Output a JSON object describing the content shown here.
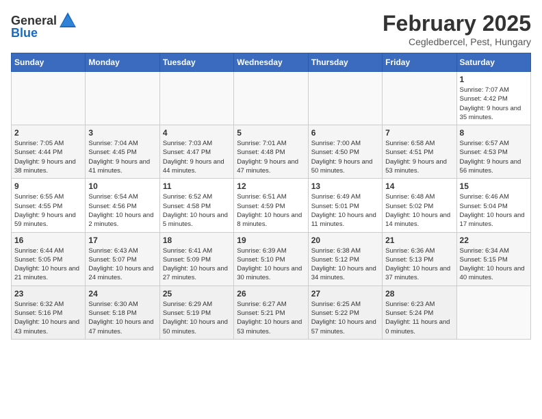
{
  "header": {
    "logo_general": "General",
    "logo_blue": "Blue",
    "month": "February 2025",
    "location": "Cegledbercel, Pest, Hungary"
  },
  "days_of_week": [
    "Sunday",
    "Monday",
    "Tuesday",
    "Wednesday",
    "Thursday",
    "Friday",
    "Saturday"
  ],
  "weeks": [
    [
      {
        "day": "",
        "info": ""
      },
      {
        "day": "",
        "info": ""
      },
      {
        "day": "",
        "info": ""
      },
      {
        "day": "",
        "info": ""
      },
      {
        "day": "",
        "info": ""
      },
      {
        "day": "",
        "info": ""
      },
      {
        "day": "1",
        "info": "Sunrise: 7:07 AM\nSunset: 4:42 PM\nDaylight: 9 hours and 35 minutes."
      }
    ],
    [
      {
        "day": "2",
        "info": "Sunrise: 7:05 AM\nSunset: 4:44 PM\nDaylight: 9 hours and 38 minutes."
      },
      {
        "day": "3",
        "info": "Sunrise: 7:04 AM\nSunset: 4:45 PM\nDaylight: 9 hours and 41 minutes."
      },
      {
        "day": "4",
        "info": "Sunrise: 7:03 AM\nSunset: 4:47 PM\nDaylight: 9 hours and 44 minutes."
      },
      {
        "day": "5",
        "info": "Sunrise: 7:01 AM\nSunset: 4:48 PM\nDaylight: 9 hours and 47 minutes."
      },
      {
        "day": "6",
        "info": "Sunrise: 7:00 AM\nSunset: 4:50 PM\nDaylight: 9 hours and 50 minutes."
      },
      {
        "day": "7",
        "info": "Sunrise: 6:58 AM\nSunset: 4:51 PM\nDaylight: 9 hours and 53 minutes."
      },
      {
        "day": "8",
        "info": "Sunrise: 6:57 AM\nSunset: 4:53 PM\nDaylight: 9 hours and 56 minutes."
      }
    ],
    [
      {
        "day": "9",
        "info": "Sunrise: 6:55 AM\nSunset: 4:55 PM\nDaylight: 9 hours and 59 minutes."
      },
      {
        "day": "10",
        "info": "Sunrise: 6:54 AM\nSunset: 4:56 PM\nDaylight: 10 hours and 2 minutes."
      },
      {
        "day": "11",
        "info": "Sunrise: 6:52 AM\nSunset: 4:58 PM\nDaylight: 10 hours and 5 minutes."
      },
      {
        "day": "12",
        "info": "Sunrise: 6:51 AM\nSunset: 4:59 PM\nDaylight: 10 hours and 8 minutes."
      },
      {
        "day": "13",
        "info": "Sunrise: 6:49 AM\nSunset: 5:01 PM\nDaylight: 10 hours and 11 minutes."
      },
      {
        "day": "14",
        "info": "Sunrise: 6:48 AM\nSunset: 5:02 PM\nDaylight: 10 hours and 14 minutes."
      },
      {
        "day": "15",
        "info": "Sunrise: 6:46 AM\nSunset: 5:04 PM\nDaylight: 10 hours and 17 minutes."
      }
    ],
    [
      {
        "day": "16",
        "info": "Sunrise: 6:44 AM\nSunset: 5:05 PM\nDaylight: 10 hours and 21 minutes."
      },
      {
        "day": "17",
        "info": "Sunrise: 6:43 AM\nSunset: 5:07 PM\nDaylight: 10 hours and 24 minutes."
      },
      {
        "day": "18",
        "info": "Sunrise: 6:41 AM\nSunset: 5:09 PM\nDaylight: 10 hours and 27 minutes."
      },
      {
        "day": "19",
        "info": "Sunrise: 6:39 AM\nSunset: 5:10 PM\nDaylight: 10 hours and 30 minutes."
      },
      {
        "day": "20",
        "info": "Sunrise: 6:38 AM\nSunset: 5:12 PM\nDaylight: 10 hours and 34 minutes."
      },
      {
        "day": "21",
        "info": "Sunrise: 6:36 AM\nSunset: 5:13 PM\nDaylight: 10 hours and 37 minutes."
      },
      {
        "day": "22",
        "info": "Sunrise: 6:34 AM\nSunset: 5:15 PM\nDaylight: 10 hours and 40 minutes."
      }
    ],
    [
      {
        "day": "23",
        "info": "Sunrise: 6:32 AM\nSunset: 5:16 PM\nDaylight: 10 hours and 43 minutes."
      },
      {
        "day": "24",
        "info": "Sunrise: 6:30 AM\nSunset: 5:18 PM\nDaylight: 10 hours and 47 minutes."
      },
      {
        "day": "25",
        "info": "Sunrise: 6:29 AM\nSunset: 5:19 PM\nDaylight: 10 hours and 50 minutes."
      },
      {
        "day": "26",
        "info": "Sunrise: 6:27 AM\nSunset: 5:21 PM\nDaylight: 10 hours and 53 minutes."
      },
      {
        "day": "27",
        "info": "Sunrise: 6:25 AM\nSunset: 5:22 PM\nDaylight: 10 hours and 57 minutes."
      },
      {
        "day": "28",
        "info": "Sunrise: 6:23 AM\nSunset: 5:24 PM\nDaylight: 11 hours and 0 minutes."
      },
      {
        "day": "",
        "info": ""
      }
    ]
  ]
}
